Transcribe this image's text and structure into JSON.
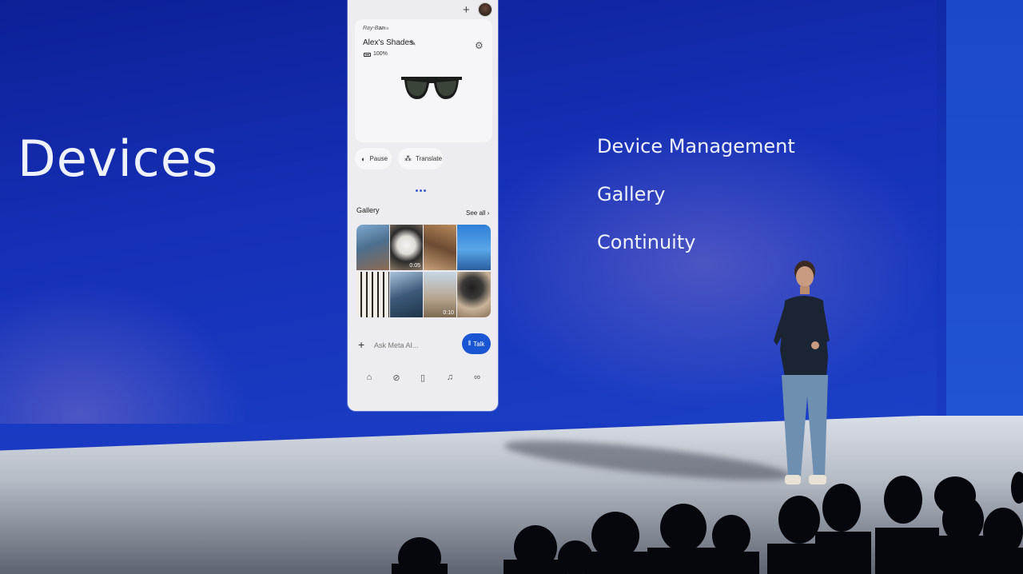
{
  "slide": {
    "title": "Devices",
    "features": [
      "Device Management",
      "Gallery",
      "Continuity"
    ]
  },
  "phone": {
    "header": {
      "add_icon": "+",
      "avatar_icon": "avatar"
    },
    "device_card": {
      "brand": "Ray-Ban",
      "brand_sub": "|Meta",
      "name": "Alex's Shades",
      "edit_icon": "✎",
      "settings_icon": "⚙",
      "battery": "100%"
    },
    "actions": [
      {
        "icon": "◐",
        "label": "Pause"
      },
      {
        "icon": "⁂",
        "label": "Translate"
      }
    ],
    "gallery": {
      "label": "Gallery",
      "see_all": "See all ›",
      "durations": [
        "0:05",
        "0:10"
      ]
    },
    "ask": {
      "plus": "+",
      "placeholder": "Ask Meta AI...",
      "talk_icon": "⦀",
      "talk_label": "Talk"
    },
    "tabs": [
      {
        "name": "home-icon",
        "glyph": "⌂"
      },
      {
        "name": "compass-icon",
        "glyph": "⊘"
      },
      {
        "name": "apps-icon",
        "glyph": "▯"
      },
      {
        "name": "bell-icon",
        "glyph": "♫"
      },
      {
        "name": "glasses-icon",
        "glyph": "∞"
      }
    ]
  },
  "colors": {
    "slide_bg": "#1530b7",
    "accent": "#1a55d4",
    "phone_bg": "#ececf1"
  }
}
